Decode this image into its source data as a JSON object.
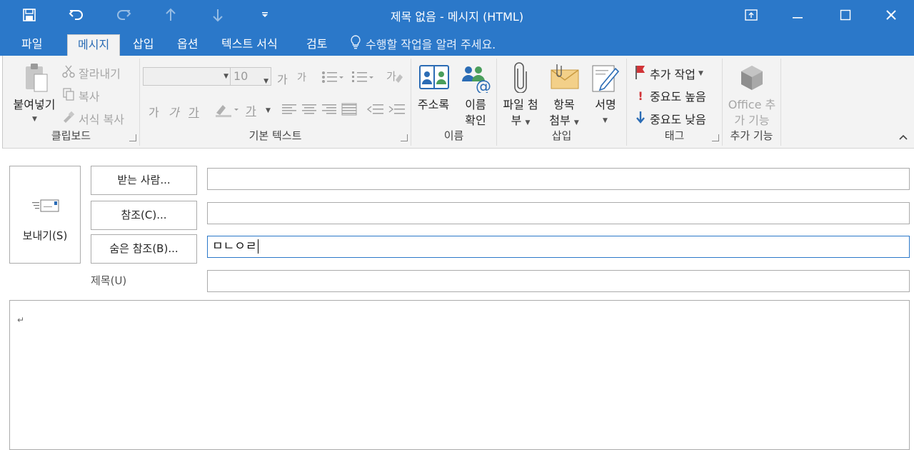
{
  "window": {
    "title": "제목 없음 - 메시지 (HTML)"
  },
  "qat": {
    "icons": [
      "save-icon",
      "undo-icon",
      "redo-icon",
      "up-arrow-icon",
      "down-arrow-icon",
      "customize-dropdown-icon"
    ]
  },
  "tabs": [
    {
      "label": "파일",
      "active": false
    },
    {
      "label": "메시지",
      "active": true
    },
    {
      "label": "삽입",
      "active": false
    },
    {
      "label": "옵션",
      "active": false
    },
    {
      "label": "텍스트 서식",
      "active": false
    },
    {
      "label": "검토",
      "active": false
    }
  ],
  "tell_me": {
    "placeholder": "수행할 작업을 알려 주세요."
  },
  "ribbon": {
    "clipboard": {
      "label": "클립보드",
      "paste": "붙여넣기",
      "cut": "잘라내기",
      "copy": "복사",
      "format_painter": "서식 복사"
    },
    "basic_text": {
      "label": "기본 텍스트",
      "font_name": "",
      "font_size": "10",
      "grow_font": "가",
      "shrink_font": "가",
      "bold": "가",
      "italic": "가",
      "underline": "가",
      "font_color": "가"
    },
    "names": {
      "label": "이름",
      "address_book": "주소록",
      "check_names_1": "이름",
      "check_names_2": "확인"
    },
    "include": {
      "label": "삽입",
      "attach_file_1": "파일 첨",
      "attach_file_2": "부",
      "attach_item_1": "항목",
      "attach_item_2": "첨부",
      "signature": "서명"
    },
    "tags": {
      "label": "태그",
      "follow_up": "추가 작업",
      "high_importance": "중요도 높음",
      "low_importance": "중요도 낮음"
    },
    "addins": {
      "label": "추가 기능",
      "office_addins_1": "Office 추",
      "office_addins_2": "가 기능"
    }
  },
  "compose": {
    "send": "보내기(S)",
    "to_button": "받는 사람...",
    "cc_button": "참조(C)...",
    "bcc_button": "숨은 참조(B)...",
    "subject_label": "제목(U)",
    "to_value": "",
    "cc_value": "",
    "bcc_value": "ㅁㄴㅇㄹ",
    "subject_value": "",
    "body_mark": "↵"
  },
  "colors": {
    "titlebar": "#2b78c9",
    "ribbon_bg": "#f3f3f3",
    "flag_red": "#d13438",
    "low_blue": "#2b6cb5"
  }
}
